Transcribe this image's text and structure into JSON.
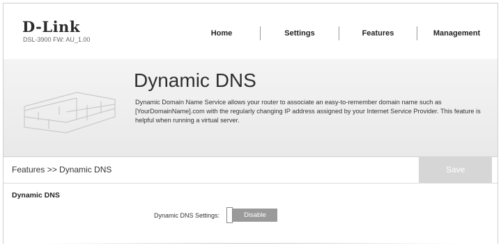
{
  "brand": {
    "logo": "D-Link",
    "model": "DSL-3900   FW: AU_1.00"
  },
  "nav": {
    "home": "Home",
    "settings": "Settings",
    "features": "Features",
    "management": "Management"
  },
  "banner": {
    "title": "Dynamic DNS",
    "description": "Dynamic Domain Name Service allows your router to associate an easy-to-remember domain name such as [YourDomainName].com with the regularly changing IP address assigned by your Internet Service Provider. This feature is helpful when running a virtual server."
  },
  "breadcrumb": "Features >> Dynamic DNS",
  "save_label": "Save",
  "section": {
    "title": "Dynamic DNS",
    "settings_label": "Dynamic DNS Settings:",
    "toggle_value": "Disable"
  },
  "colors": {
    "save_disabled": "#d6d6d6",
    "toggle_off": "#9a9a9a"
  }
}
